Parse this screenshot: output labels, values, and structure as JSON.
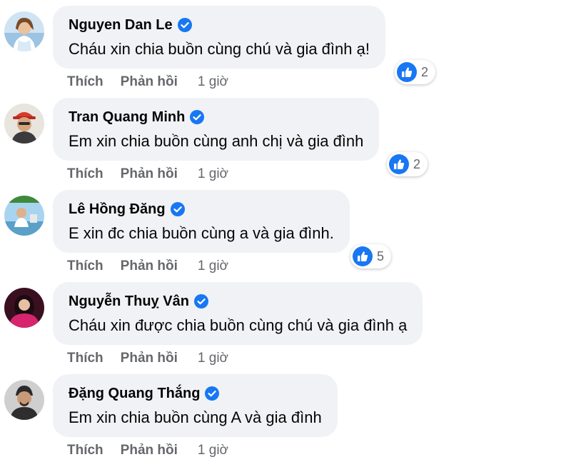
{
  "colors": {
    "bubble": "#f0f2f5",
    "meta": "#65676b",
    "verified": "#1877f2",
    "like": "#1877f2"
  },
  "comments": [
    {
      "author": "Nguyen Dan Le",
      "text": "Cháu xin chia buồn cùng chú và gia đình ạ!",
      "like_label": "Thích",
      "reply_label": "Phản hồi",
      "time": "1 giờ",
      "reactions": "2"
    },
    {
      "author": "Tran Quang Minh",
      "text": "Em xin chia buồn cùng anh chị và gia đình",
      "like_label": "Thích",
      "reply_label": "Phản hồi",
      "time": "1 giờ",
      "reactions": "2"
    },
    {
      "author": "Lê Hồng Đăng",
      "text": "E xin đc chia buồn cùng a và gia đình.",
      "like_label": "Thích",
      "reply_label": "Phản hồi",
      "time": "1 giờ",
      "reactions": "5"
    },
    {
      "author": "Nguyễn Thuỵ Vân",
      "text": "Cháu xin được chia buồn cùng chú và gia đình ạ",
      "like_label": "Thích",
      "reply_label": "Phản hồi",
      "time": "1 giờ"
    },
    {
      "author": "Đặng Quang Thắng",
      "text": "Em xin chia buồn cùng A và gia đình",
      "like_label": "Thích",
      "reply_label": "Phản hồi",
      "time": "1 giờ"
    }
  ]
}
